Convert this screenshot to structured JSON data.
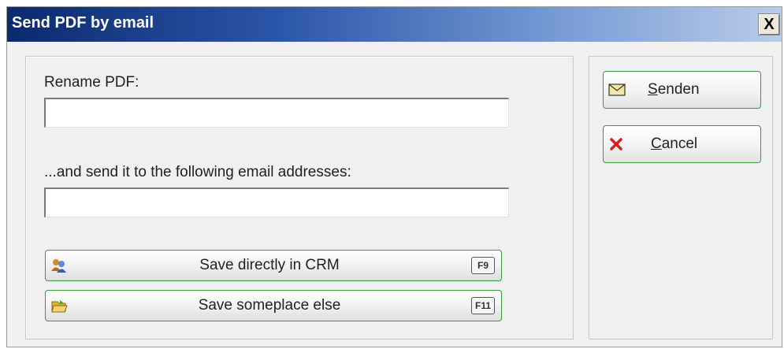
{
  "window": {
    "title": "Send PDF by email",
    "close_label": "X"
  },
  "form": {
    "rename_label": "Rename PDF:",
    "rename_value": "",
    "email_label": "...and send it to the following email addresses:",
    "email_value": ""
  },
  "actions": [
    {
      "label": "Save directly in CRM",
      "key": "F9",
      "icon": "crm-users-icon"
    },
    {
      "label": "Save someplace else",
      "key": "F11",
      "icon": "folder-open-icon"
    }
  ],
  "sidebar": {
    "send": {
      "label_underlined": "S",
      "label_rest": "enden",
      "icon": "envelope-icon"
    },
    "cancel": {
      "label_underlined": "C",
      "label_rest": "ancel",
      "icon": "red-x-icon"
    }
  },
  "colors": {
    "accent_border": "#3c9a3c",
    "title_start": "#0b2a6e",
    "title_end": "#b9cce8"
  }
}
